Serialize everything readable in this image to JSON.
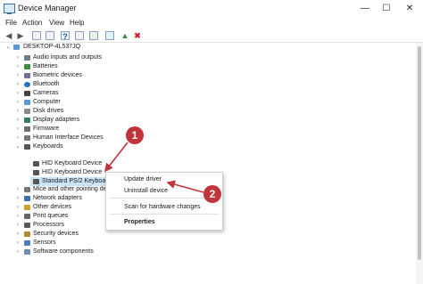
{
  "window": {
    "title": "Device Manager",
    "minimize": "—",
    "maximize": "☐",
    "close": "✕"
  },
  "menu": [
    "File",
    "Action",
    "View",
    "Help"
  ],
  "toolbar": {
    "back": "◀",
    "forward": "▶",
    "help": "?",
    "update": "▲",
    "remove": "✖"
  },
  "tree": {
    "root": "DESKTOP-4L537JQ",
    "categories": [
      "Audio inputs and outputs",
      "Batteries",
      "Biometric devices",
      "Bluetooth",
      "Cameras",
      "Computer",
      "Disk drives",
      "Display adapters",
      "Firmware",
      "Human Interface Devices",
      "Keyboards",
      "Mice and other pointing devices",
      "Network adapters",
      "Other devices",
      "Print queues",
      "Processors",
      "Security devices",
      "Sensors",
      "Software components"
    ],
    "keyboards": [
      "HID Keyboard Device",
      "HID Keyboard Device",
      "Standard PS/2 Keyboard"
    ]
  },
  "context_menu": {
    "update_driver": "Update driver",
    "uninstall_device": "Uninstall device",
    "scan": "Scan for hardware changes",
    "properties": "Properties"
  },
  "annotations": {
    "step1": "1",
    "step2": "2"
  },
  "colors": {
    "annotation_red": "#c0343c",
    "selection": "#cce4f7"
  }
}
